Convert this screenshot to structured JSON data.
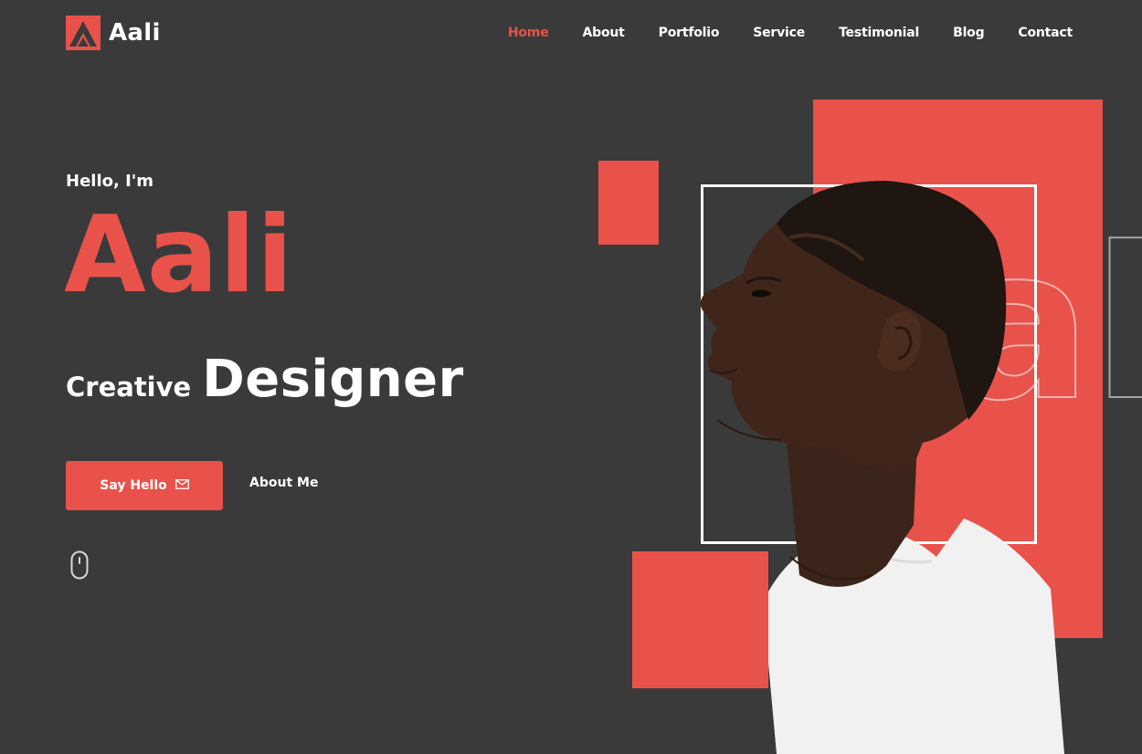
{
  "brand": {
    "name": "Aali",
    "accent_color": "#e8524a",
    "background_color": "#3a3a3b"
  },
  "nav": {
    "items": [
      {
        "label": "Home",
        "active": true
      },
      {
        "label": "About",
        "active": false
      },
      {
        "label": "Portfolio",
        "active": false
      },
      {
        "label": "Service",
        "active": false
      },
      {
        "label": "Testimonial",
        "active": false
      },
      {
        "label": "Blog",
        "active": false
      },
      {
        "label": "Contact",
        "active": false
      }
    ]
  },
  "hero": {
    "greeting": "Hello, I'm",
    "name": "Aali",
    "role_prefix": "Creative",
    "role_main": "Designer",
    "primary_button": {
      "label": "Say Hello",
      "icon": "envelope-icon"
    },
    "secondary_link": {
      "label": "About Me"
    },
    "scroll_icon": "mouse-icon",
    "background_word": "ali"
  }
}
